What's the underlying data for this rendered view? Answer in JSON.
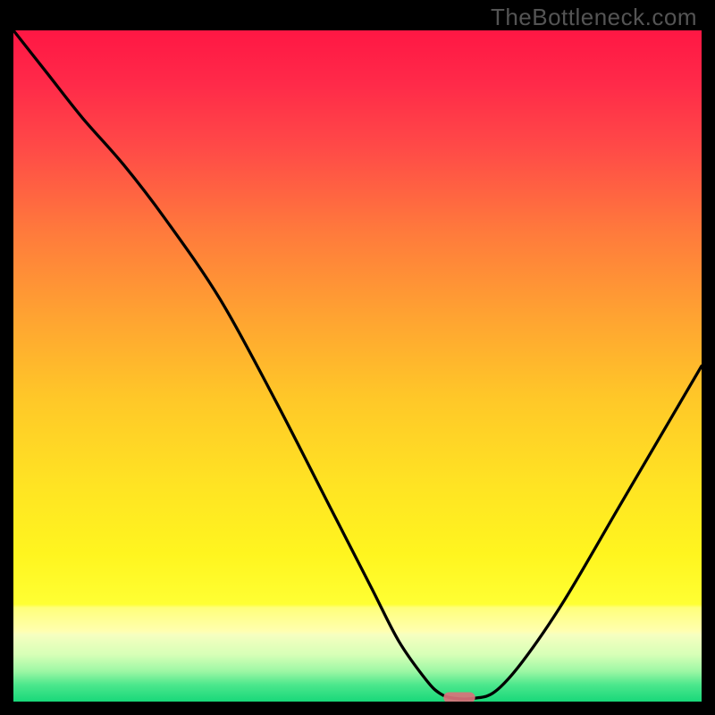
{
  "watermark": "TheBottleneck.com",
  "colors": {
    "background": "#000000",
    "gradient_stops": [
      {
        "offset": 0.0,
        "color": "#ff1744"
      },
      {
        "offset": 0.08,
        "color": "#ff2a49"
      },
      {
        "offset": 0.18,
        "color": "#ff4c47"
      },
      {
        "offset": 0.3,
        "color": "#ff7a3c"
      },
      {
        "offset": 0.42,
        "color": "#ffa132"
      },
      {
        "offset": 0.55,
        "color": "#ffc828"
      },
      {
        "offset": 0.68,
        "color": "#ffe423"
      },
      {
        "offset": 0.78,
        "color": "#fff51f"
      },
      {
        "offset": 0.855,
        "color": "#ffff33"
      },
      {
        "offset": 0.86,
        "color": "#ffff7a"
      },
      {
        "offset": 0.895,
        "color": "#ffffb0"
      },
      {
        "offset": 0.9,
        "color": "#f6ffc0"
      },
      {
        "offset": 0.93,
        "color": "#d7ffb7"
      },
      {
        "offset": 0.955,
        "color": "#9cf7a4"
      },
      {
        "offset": 0.975,
        "color": "#4ce78c"
      },
      {
        "offset": 1.0,
        "color": "#18d87a"
      }
    ],
    "curve": "#000000",
    "marker": "#d9727b"
  },
  "chart_data": {
    "type": "line",
    "title": "",
    "xlabel": "",
    "ylabel": "",
    "xlim": [
      0,
      100
    ],
    "ylim": [
      0,
      100
    ],
    "legend": false,
    "series": [
      {
        "name": "bottleneck-curve",
        "x": [
          0,
          5,
          10,
          16,
          22,
          30,
          38,
          46,
          52,
          56,
          60,
          62,
          64,
          67,
          70,
          74,
          80,
          88,
          96,
          100
        ],
        "values": [
          100,
          93.5,
          87,
          80,
          72,
          60,
          45,
          29,
          17,
          9,
          3.2,
          1.2,
          0.5,
          0.5,
          1.5,
          6,
          15,
          29,
          43,
          50
        ]
      }
    ],
    "marker": {
      "name": "optimum-marker",
      "x_center": 64.8,
      "y_value": 0.6,
      "width_x": 4.6,
      "height_y": 1.6,
      "shape": "pill"
    }
  }
}
